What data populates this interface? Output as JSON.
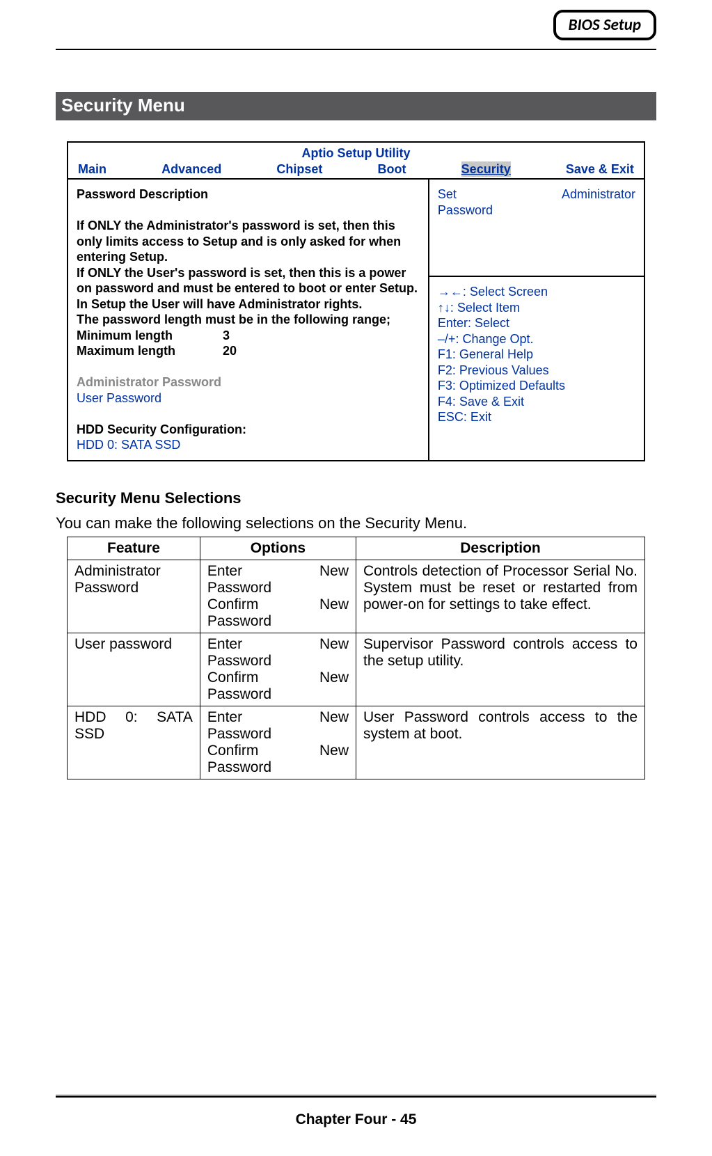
{
  "badge": "BIOS Setup",
  "section_title": "Security Menu",
  "bios": {
    "utility_title": "Aptio Setup Utility",
    "tabs": {
      "main": "Main",
      "advanced": "Advanced",
      "chipset": "Chipset",
      "boot": "Boot",
      "security": "Security",
      "save_exit": "Save & Exit"
    },
    "left": {
      "heading": "Password Description",
      "para1": "If ONLY the Administrator's password is set, then this only limits access to Setup and is only asked for when entering Setup.",
      "para2": "If ONLY the User's password is set, then this is a power on password and must be entered to boot or enter Setup. In Setup the User will have Administrator rights.",
      "range_line": "The password length must be in the following range;",
      "min_label": "Minimum length",
      "min_val": "3",
      "max_label": "Maximum length",
      "max_val": "20",
      "admin_pw": "Administrator Password",
      "user_pw": "User Password",
      "hdd_heading": "HDD Security Configuration:",
      "hdd_item": "HDD 0: SATA SSD"
    },
    "right": {
      "action_set": "Set",
      "action_admin": "Administrator",
      "action_password": "Password",
      "help": {
        "l1": "→←: Select Screen",
        "l2": "↑↓: Select Item",
        "l3": "Enter: Select",
        "l4": "–/+: Change Opt.",
        "l5": "F1: General Help",
        "l6": "F2: Previous Values",
        "l7": "F3: Optimized Defaults",
        "l8": "F4: Save & Exit",
        "l9": "ESC: Exit"
      }
    }
  },
  "selections": {
    "heading": "Security Menu Selections",
    "intro": "You can make the following selections on the Security Menu.",
    "headers": {
      "feature": "Feature",
      "options": "Options",
      "description": "Description"
    },
    "rows": [
      {
        "feature": "Administrator Password",
        "opt1a": "Enter",
        "opt1b": "New",
        "opt1c": "Password",
        "opt2a": "Confirm",
        "opt2b": "New",
        "opt2c": "Password",
        "desc": "Controls detection of Processor Serial No. System must be reset or restarted from power-on for settings to take effect."
      },
      {
        "feature": "User password",
        "opt1a": "Enter",
        "opt1b": "New",
        "opt1c": "Password",
        "opt2a": "Confirm",
        "opt2b": "New",
        "opt2c": "Password",
        "desc": "Supervisor Password controls access to the setup utility."
      },
      {
        "feature": "HDD 0: SATA SSD",
        "opt1a": "Enter",
        "opt1b": "New",
        "opt1c": "Password",
        "opt2a": "Confirm",
        "opt2b": "New",
        "opt2c": "Password",
        "desc": "User Password controls access to the system at boot."
      }
    ]
  },
  "footer": "Chapter Four - 45"
}
